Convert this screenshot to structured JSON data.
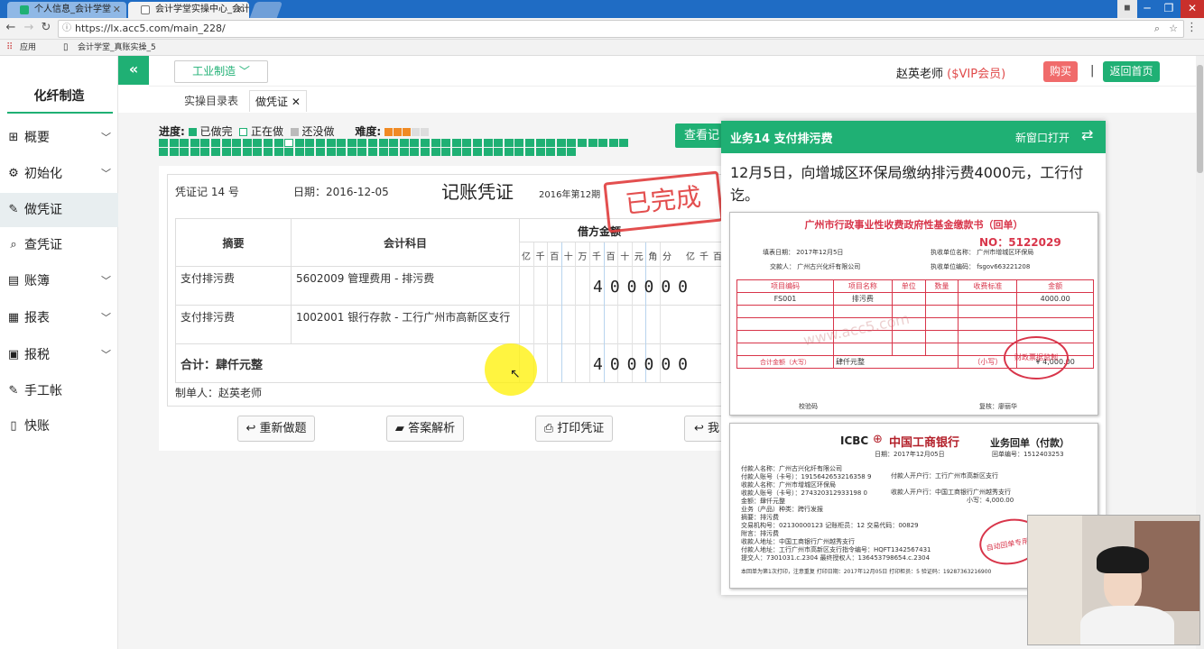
{
  "browser": {
    "tabs": [
      {
        "title": "个人信息_会计学堂"
      },
      {
        "title": "会计学堂实操中心_会计..."
      }
    ],
    "url": "https://lx.acc5.com/main_228/",
    "bookmarks": [
      "应用",
      "会计学堂_真账实操_5"
    ]
  },
  "sidebar": {
    "company": "化纤制造",
    "items": [
      {
        "label": "概要",
        "icon": "grid-icon"
      },
      {
        "label": "初始化",
        "icon": "gear-icon"
      },
      {
        "label": "做凭证",
        "icon": "pen-icon"
      },
      {
        "label": "查凭证",
        "icon": "search-icon"
      },
      {
        "label": "账簿",
        "icon": "book-icon"
      },
      {
        "label": "报表",
        "icon": "report-icon"
      },
      {
        "label": "报税",
        "icon": "tax-icon"
      },
      {
        "label": "手工帐",
        "icon": "pen-icon"
      },
      {
        "label": "快账",
        "icon": "file-icon"
      }
    ]
  },
  "topbar": {
    "industry": "工业制造",
    "teacher_name": "赵英老师",
    "vip": "($VIP会员)",
    "buy": "购买",
    "divider": "|",
    "home": "返回首页"
  },
  "subtabs": {
    "catalog": "实操目录表",
    "current": "做凭证"
  },
  "progress": {
    "label": "进度:",
    "done": "已做完",
    "doing": "正在做",
    "todo": "还没做",
    "difficulty_label": "难度:",
    "difficulty": 3,
    "difficulty_max": 5,
    "total_tasks": 85,
    "done_tasks": 84
  },
  "check_button": "查看记",
  "voucher": {
    "number": "凭证记 14 号",
    "date": "日期：2016-12-05",
    "title": "记账凭证",
    "period": "2016年第12期",
    "head_summary": "摘要",
    "head_account": "会计科目",
    "head_debit": "借方金额",
    "digit_units": [
      "亿",
      "千",
      "百",
      "十",
      "万",
      "千",
      "百",
      "十",
      "元",
      "角",
      "分"
    ],
    "rows": [
      {
        "summary": "支付排污费",
        "account": "5602009 管理费用 - 排污费",
        "debit": "400000"
      },
      {
        "summary": "支付排污费",
        "account": "1002001 银行存款 - 工行广州市高新区支行",
        "debit": ""
      }
    ],
    "total_label": "合计：肆仟元整",
    "total_debit": "400000",
    "maker": "制单人：赵英老师",
    "stamp": "已完成"
  },
  "actions": {
    "redo": "重新做题",
    "answer": "答案解析",
    "print": "打印凭证",
    "my": "我"
  },
  "task": {
    "title": "业务14 支付排污费",
    "open_new": "新窗口打开",
    "description": "12月5日，向增城区环保局缴纳排污费4000元，工行付讫。"
  },
  "receipt": {
    "title": "广州市行政事业性收费政府性基金缴款书（回单）",
    "no": "NO：5122029",
    "fill_date": "填表日期：  2017年12月5日",
    "payer": "交款人：  广州古兴化纤有限公司",
    "collector": "执收单位名称：  广州市增城区环保局",
    "collector_code": "执收单位编码：  fsgov663221208",
    "cols": [
      "项目编码",
      "项目名称",
      "单位",
      "数量",
      "收费标准",
      "金额"
    ],
    "item": [
      "FS001",
      "排污费",
      "",
      "",
      "",
      "4000.00"
    ],
    "total_label": "合计金额（大写）",
    "total_words": "肆仟元整",
    "small_label": "（小写）",
    "total": "¥        4,000.00",
    "check_code": "校验码",
    "reviewer": "复核：廖丽华",
    "seal": "财政票据监制",
    "watermark": "www.acc5.com"
  },
  "bank": {
    "brand": "ICBC",
    "name": "中国工商银行",
    "title": "业务回单（付款）",
    "date": "日期：2017年12月05日",
    "no": "回单编号：1512403253",
    "lines": [
      "付款人名称：广州古兴化纤有限公司",
      "付款人账号（卡号）：1915642653216358 9",
      "收款人名称：广州市增城区环保局",
      "收款人账号（卡号）：274320312933198 0",
      "金额：肆仟元整",
      "业务（产品）种类：跨行发报",
      "摘要：排污费",
      "交易机构号：02130000123  记账柜员：12  交易代码：00829",
      "附言：排污费",
      "收款人地址：中国工商银行广州越秀支行",
      "付款人地址：工行广州市高新区支行指令编号：HQFT1342567431",
      "提交人：7301031.c.2304  最终授权人：136453798654.c.2304"
    ],
    "payer_bank": "付款人开户行：工行广州市高新区支行",
    "payee_bank": "收款人开户行：中国工商银行广州越秀支行",
    "amount": "小写：4,000.00",
    "footer": "本回单为第1次打印，注意重复  打印日期：2017年12月05日  打印柜员：5  验证码：19287363216900",
    "seal": "自动回单专用章"
  }
}
